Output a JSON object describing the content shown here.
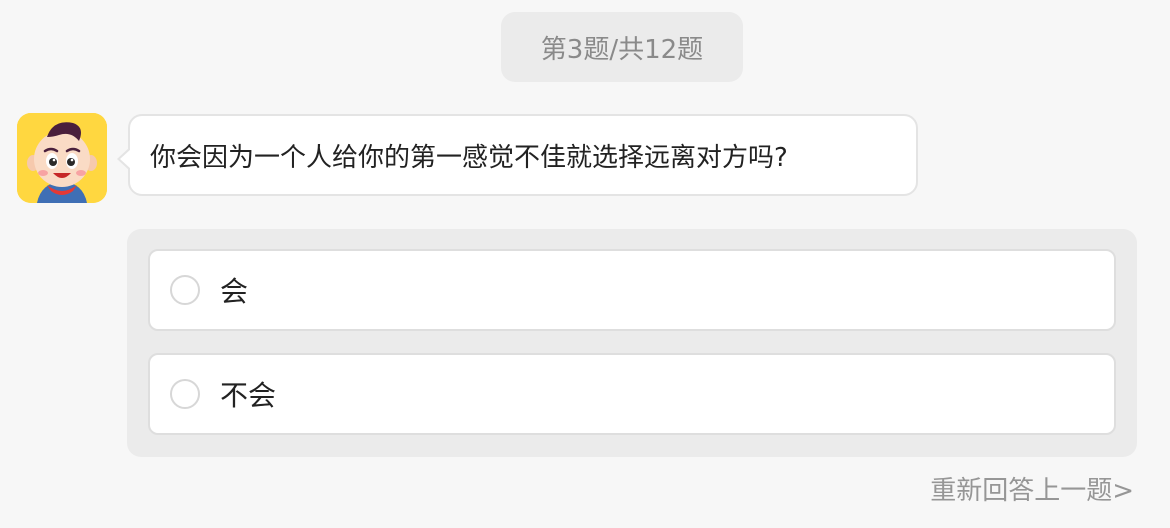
{
  "progress": {
    "label": "第3题/共12题"
  },
  "question": {
    "text": "你会因为一个人给你的第一感觉不佳就选择远离对方吗?"
  },
  "options": [
    {
      "label": "会"
    },
    {
      "label": "不会"
    }
  ],
  "footer": {
    "redo_label": "重新回答上一题>"
  },
  "colors": {
    "background": "#f7f7f7",
    "pill_background": "#ebebeb",
    "avatar_background": "#ffd740",
    "text_primary": "#222222",
    "text_muted": "#8a8a8a"
  },
  "icons": {
    "avatar": "cartoon-boy-avatar",
    "radio": "radio-unchecked-icon"
  }
}
